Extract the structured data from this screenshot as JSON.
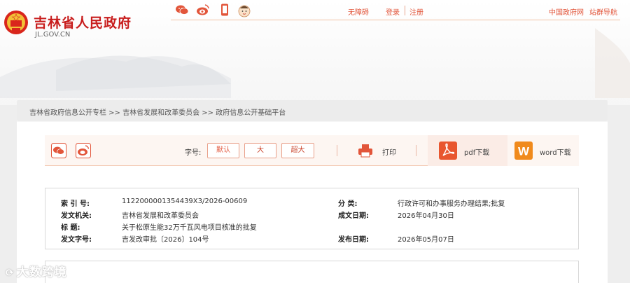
{
  "header": {
    "site_title": "吉林省人民政府",
    "site_domain": "JL.GOV.CN",
    "links": {
      "accessibility": "无障碍",
      "login": "登录",
      "register": "注册",
      "china_gov": "中国政府网",
      "site_nav": "站群导航"
    },
    "social_icons": [
      "wechat-icon",
      "weibo-icon",
      "mobile-icon",
      "mascot-icon"
    ]
  },
  "breadcrumb": {
    "text": "吉林省政府信息公开专栏 >> 吉林省发展和改革委员会 >> 政府信息公开基础平台"
  },
  "toolbar": {
    "font_size_label": "字号:",
    "font_sizes": [
      "默认",
      "大",
      "超大"
    ],
    "print_label": "打印",
    "pdf_label": "pdf下载",
    "word_label": "word下载",
    "colors": {
      "accent": "#e2553a",
      "pdf": "#e8562f",
      "word": "#f08a1c"
    }
  },
  "meta": {
    "index_key": "索  引  号:",
    "index_value": "1122000001354439X3/2026-00609",
    "category_key": "分      类:",
    "category_value": "行政许可和办事服务办理结果;批复",
    "issuer_key": "发文机关:",
    "issuer_value": "吉林省发展和改革委员会",
    "written_date_key": "成文日期:",
    "written_date_value": "2026年04月30日",
    "title_key": "标      题:",
    "title_value": "关于松原生能32万千瓦风电项目核准的批复",
    "doc_no_key": "发文字号:",
    "doc_no_value": "吉发改审批〔2026〕104号",
    "publish_date_key": "发布日期:",
    "publish_date_value": "2026年05月07日"
  },
  "watermark": "大数跨境"
}
